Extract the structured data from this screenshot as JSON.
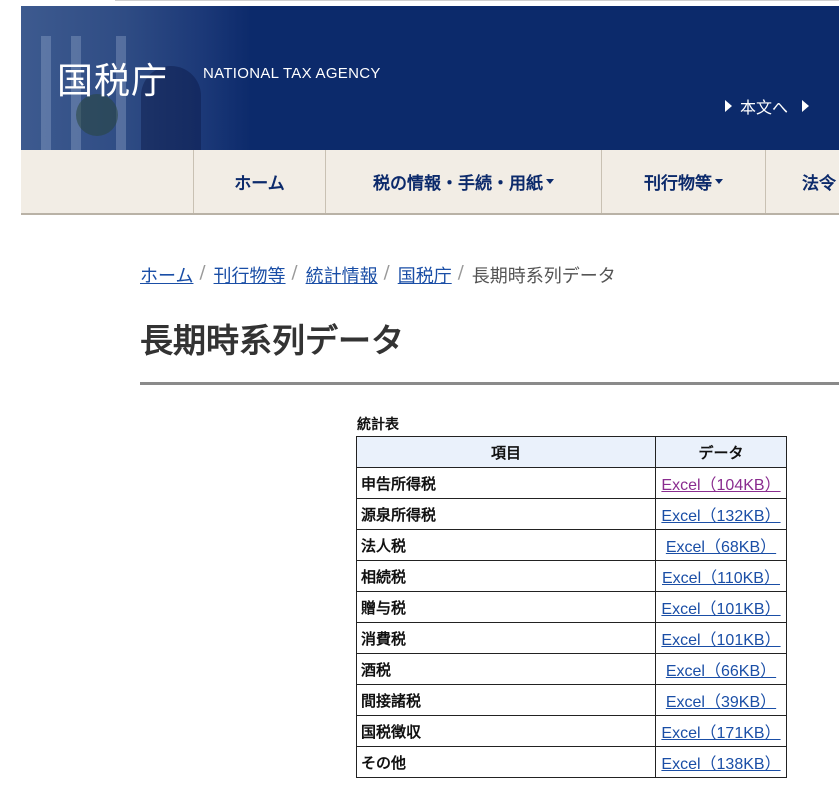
{
  "header": {
    "logo_jp": "国税庁",
    "logo_en": "NATIONAL TAX AGENCY",
    "skip_links": [
      "本文へ",
      ""
    ]
  },
  "nav": {
    "items": [
      {
        "label": "ホーム",
        "dropdown": false
      },
      {
        "label": "税の情報・手続・用紙",
        "dropdown": true
      },
      {
        "label": "刊行物等",
        "dropdown": true
      },
      {
        "label": "法令",
        "dropdown": false
      }
    ]
  },
  "breadcrumb": [
    "ホーム",
    "刊行物等",
    "統計情報",
    "国税庁",
    "長期時系列データ"
  ],
  "page_title": "長期時系列データ",
  "table": {
    "caption": "統計表",
    "headers": [
      "項目",
      "データ"
    ],
    "rows": [
      {
        "name": "申告所得税",
        "link": "Excel（104KB）",
        "visited": true
      },
      {
        "name": "源泉所得税",
        "link": "Excel（132KB）",
        "visited": false
      },
      {
        "name": "法人税",
        "link": "Excel（68KB）",
        "visited": false
      },
      {
        "name": "相続税",
        "link": "Excel（110KB）",
        "visited": false
      },
      {
        "name": "贈与税",
        "link": "Excel（101KB）",
        "visited": false
      },
      {
        "name": "消費税",
        "link": "Excel（101KB）",
        "visited": false
      },
      {
        "name": "酒税",
        "link": "Excel（66KB）",
        "visited": false
      },
      {
        "name": "間接諸税",
        "link": "Excel（39KB）",
        "visited": false
      },
      {
        "name": "国税徴収",
        "link": "Excel（171KB）",
        "visited": false
      },
      {
        "name": "その他",
        "link": "Excel（138KB）",
        "visited": false
      }
    ]
  },
  "colors": {
    "header_bg": "#0c2a6b",
    "nav_bg": "#f2ede5",
    "link": "#1a4ea6",
    "visited_link": "#8a2c8f"
  }
}
